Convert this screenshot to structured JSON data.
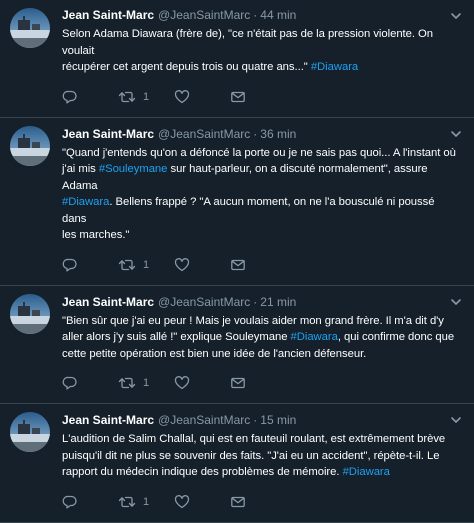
{
  "colors": {
    "background": "#15202b",
    "divider": "#38444d",
    "text": "#ffffff",
    "muted": "#8899a6",
    "hashtag": "#1da1f2"
  },
  "tweets": [
    {
      "name": "Jean Saint-Marc",
      "handle": "@JeanSaintMarc",
      "time": "44 min",
      "lines": [
        {
          "text": "Selon Adama Diawara (frère de), \"ce n'était pas de la pression violente. On voulait",
          "tag": ""
        },
        {
          "text": "récupérer cet argent depuis trois ou quatre ans...\" ",
          "tag": "#Diawara"
        }
      ],
      "reply_count": "",
      "retweet_count": "1",
      "like_count": "",
      "icons": [
        "reply-icon",
        "retweet-icon",
        "like-icon",
        "direct-message-icon"
      ]
    },
    {
      "name": "Jean Saint-Marc",
      "handle": "@JeanSaintMarc",
      "time": "36 min",
      "lines": [
        {
          "text": "\"Quand j'entends qu'on a défoncé la porte ou je ne sais pas quoi... A l'instant où",
          "tag": ""
        },
        {
          "text": "j'ai mis ",
          "tag": "#Souleymane",
          "after": " sur haut-parleur, on a discuté normalement\", assure Adama"
        },
        {
          "text": "",
          "tag": "#Diawara",
          "after": ". Bellens frappé ? \"A aucun moment, on ne l'a bousculé ni poussé dans"
        },
        {
          "text": "les marches.\"",
          "tag": ""
        }
      ],
      "reply_count": "",
      "retweet_count": "1",
      "like_count": "",
      "icons": [
        "reply-icon",
        "retweet-icon",
        "like-icon",
        "direct-message-icon"
      ]
    },
    {
      "name": "Jean Saint-Marc",
      "handle": "@JeanSaintMarc",
      "time": "21 min",
      "lines": [
        {
          "text": "\"Bien sûr que j'ai eu peur ! Mais je voulais aider mon grand frère. Il m'a dit d'y",
          "tag": ""
        },
        {
          "text": "aller alors j'y suis allé !\" explique Souleymane ",
          "tag": "#Diawara",
          "after": ", qui confirme donc que"
        },
        {
          "text": "cette petite opération est bien une idée de l'ancien défenseur.",
          "tag": ""
        }
      ],
      "reply_count": "",
      "retweet_count": "1",
      "like_count": "",
      "icons": [
        "reply-icon",
        "retweet-icon",
        "like-icon",
        "direct-message-icon"
      ]
    },
    {
      "name": "Jean Saint-Marc",
      "handle": "@JeanSaintMarc",
      "time": "15 min",
      "lines": [
        {
          "text": "L'audition de Salim Challal, qui est en fauteuil roulant, est extrêmement brève",
          "tag": ""
        },
        {
          "text": "puisqu'il dit ne plus se souvenir des faits. \"J'ai eu un accident\", répète-t-il. Le",
          "tag": ""
        },
        {
          "text": "rapport du médecin indique des problèmes de mémoire. ",
          "tag": "#Diawara"
        }
      ],
      "reply_count": "",
      "retweet_count": "1",
      "like_count": "",
      "icons": [
        "reply-icon",
        "retweet-icon",
        "like-icon",
        "direct-message-icon"
      ]
    }
  ]
}
